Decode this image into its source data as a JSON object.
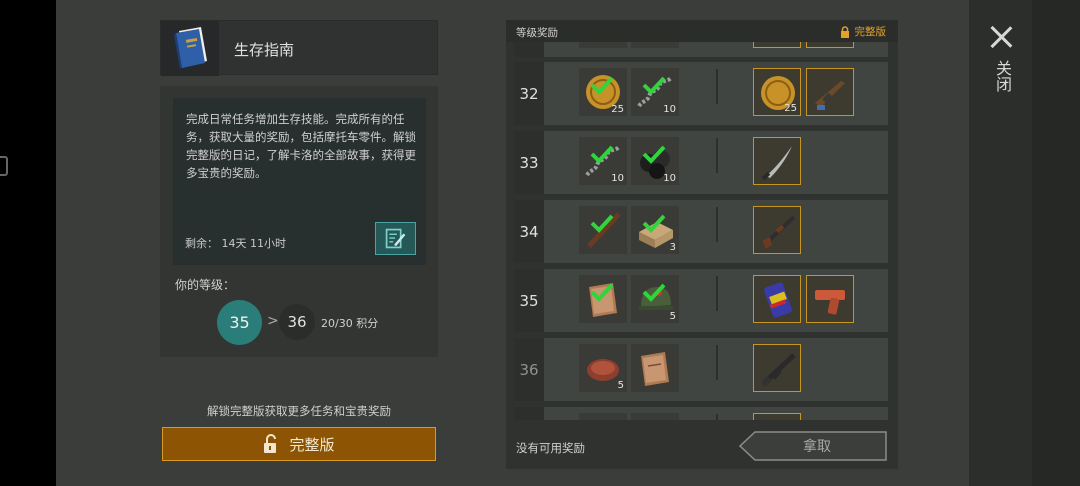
{
  "title": "生存指南",
  "description": "完成日常任务增加生存技能。完成所有的任务，获取大量的奖励，包括摩托车零件。解锁完整版的日记，了解卡洛的全部故事，获得更多宝贵的奖励。",
  "remaining": "剩余： 14天 11小时",
  "level": {
    "label": "你的等级：",
    "current": "35",
    "next": "36",
    "points": "20/30 积分"
  },
  "unlock_hint": "解锁完整版获取更多任务和宝贵奖励",
  "full_version_button": "完整版",
  "rewards": {
    "title": "等级奖励",
    "full_tag": "完整版",
    "rows": [
      {
        "level": "32",
        "free": [
          {
            "icon": "coin-icon",
            "qty": "25"
          },
          {
            "icon": "spring-icon",
            "qty": "10"
          }
        ],
        "premium": [
          {
            "icon": "coin-icon",
            "qty": "25"
          },
          {
            "icon": "rifle-icon",
            "qty": ""
          }
        ]
      },
      {
        "level": "33",
        "free": [
          {
            "icon": "spring-icon",
            "qty": "10"
          },
          {
            "icon": "ore-icon",
            "qty": "10"
          }
        ],
        "premium": [
          {
            "icon": "sword-icon",
            "qty": ""
          }
        ]
      },
      {
        "level": "34",
        "free": [
          {
            "icon": "stick-icon",
            "qty": ""
          },
          {
            "icon": "crate-icon",
            "qty": "3"
          }
        ],
        "premium": [
          {
            "icon": "shotgun-icon",
            "qty": ""
          }
        ]
      },
      {
        "level": "35",
        "free": [
          {
            "icon": "book-icon",
            "qty": ""
          },
          {
            "icon": "helmet-icon",
            "qty": "5"
          }
        ],
        "premium": [
          {
            "icon": "can-icon",
            "qty": ""
          },
          {
            "icon": "flaregun-icon",
            "qty": ""
          }
        ]
      },
      {
        "level": "36",
        "free": [
          {
            "icon": "meat-icon",
            "qty": "5"
          },
          {
            "icon": "book-icon",
            "qty": ""
          }
        ],
        "premium": [
          {
            "icon": "assault-rifle-icon",
            "qty": ""
          }
        ]
      }
    ],
    "footer_text": "没有可用奖励",
    "claim_button": "拿取"
  },
  "close_label": "关闭",
  "colors": {
    "accent_teal": "#2b7d79",
    "accent_gold": "#c8961f",
    "button_orange": "#8d5503",
    "check_green": "#2fd53a"
  }
}
